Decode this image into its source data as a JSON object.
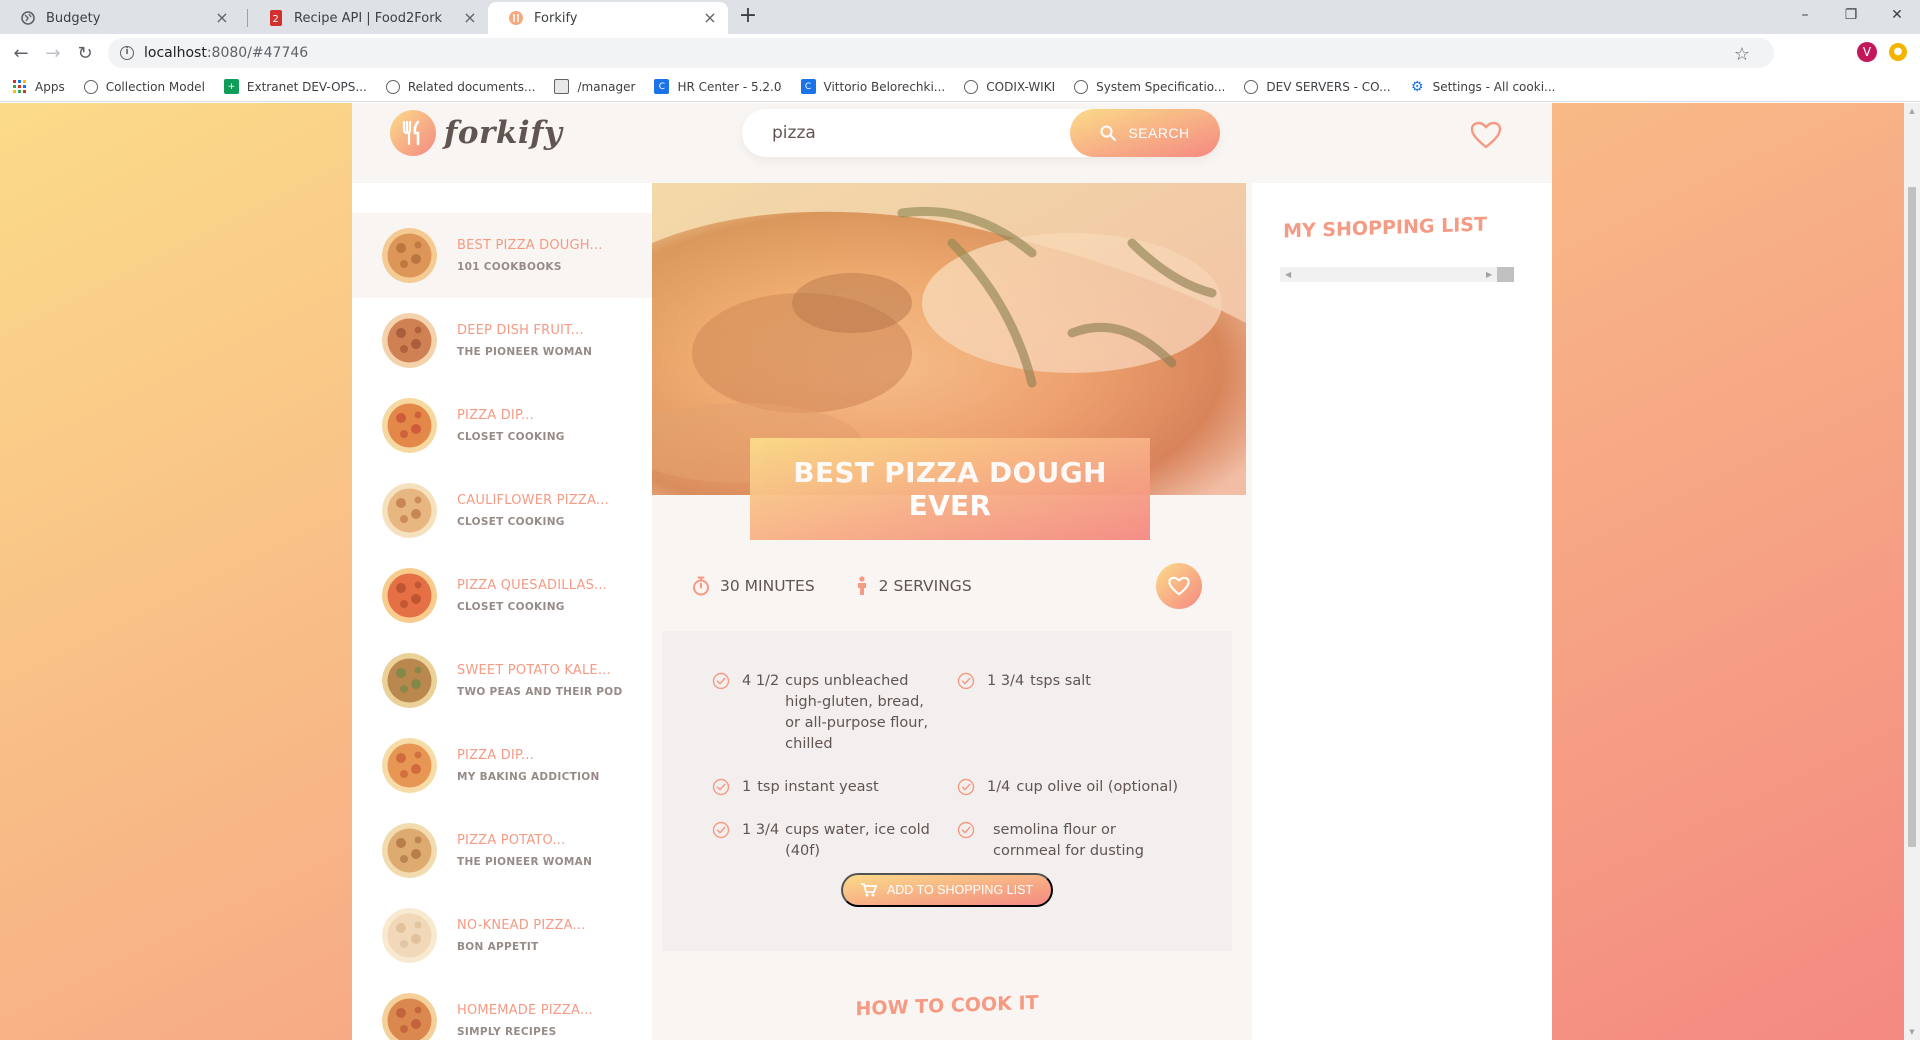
{
  "browser": {
    "tabs": [
      {
        "title": "Budgety",
        "icon": "globe-icon"
      },
      {
        "title": "Recipe API | Food2Fork",
        "icon": "food2fork-icon"
      },
      {
        "title": "Forkify",
        "icon": "forkify-icon"
      }
    ],
    "url": {
      "host": "localhost",
      "path": ":8080/#47746"
    },
    "profile_initial": "V",
    "bookmarks": [
      {
        "label": "Apps",
        "icon": "apps-grid-icon"
      },
      {
        "label": "Collection Model",
        "icon": "globe-icon"
      },
      {
        "label": "Extranet DEV-OPS...",
        "icon": "extranet-icon"
      },
      {
        "label": "Related documents...",
        "icon": "globe-icon"
      },
      {
        "label": "/manager",
        "icon": "image-icon"
      },
      {
        "label": "HR Center - 5.2.0",
        "icon": "confluence-icon"
      },
      {
        "label": "Vittorio Belorechki...",
        "icon": "confluence-icon"
      },
      {
        "label": "CODIX-WIKI",
        "icon": "globe-icon"
      },
      {
        "label": "System Specificatio...",
        "icon": "globe-icon"
      },
      {
        "label": "DEV SERVERS - CO...",
        "icon": "globe-icon"
      },
      {
        "label": "Settings - All cooki...",
        "icon": "settings-gear-icon"
      }
    ]
  },
  "app": {
    "logo_text": "forkify",
    "search": {
      "value": "pizza",
      "button_label": "SEARCH"
    },
    "results": [
      {
        "title": "BEST PIZZA DOUGH...",
        "author": "101 COOKBOOKS",
        "active": true
      },
      {
        "title": "DEEP DISH FRUIT...",
        "author": "THE PIONEER WOMAN"
      },
      {
        "title": "PIZZA DIP...",
        "author": "CLOSET COOKING"
      },
      {
        "title": "CAULIFLOWER PIZZA...",
        "author": "CLOSET COOKING"
      },
      {
        "title": "PIZZA QUESADILLAS...",
        "author": "CLOSET COOKING"
      },
      {
        "title": "SWEET POTATO KALE...",
        "author": "TWO PEAS AND THEIR POD"
      },
      {
        "title": "PIZZA DIP...",
        "author": "MY BAKING ADDICTION"
      },
      {
        "title": "PIZZA POTATO...",
        "author": "THE PIONEER WOMAN"
      },
      {
        "title": "NO-KNEAD PIZZA...",
        "author": "BON APPETIT"
      },
      {
        "title": "HOMEMADE PIZZA...",
        "author": "SIMPLY RECIPES"
      }
    ],
    "recipe": {
      "title": "BEST PIZZA DOUGH EVER",
      "time": "30",
      "time_unit": "MINUTES",
      "servings": "2",
      "servings_unit": "SERVINGS",
      "ingredients": [
        {
          "count": "4 1/2",
          "text": "cups unbleached high-gluten, bread, or all-purpose flour, chilled"
        },
        {
          "count": "1 3/4",
          "text": "tsps salt"
        },
        {
          "count": "1",
          "text": "tsp instant yeast"
        },
        {
          "count": "1/4",
          "text": "cup olive oil (optional)"
        },
        {
          "count": "1 3/4",
          "text": "cups water, ice cold (40f)"
        },
        {
          "count": "",
          "text": "semolina flour or cornmeal for dusting"
        }
      ],
      "add_to_list_label": "ADD TO SHOPPING LIST",
      "directions_title": "HOW TO COOK IT"
    },
    "shopping": {
      "title": "MY SHOPPING LIST"
    }
  },
  "colors": {
    "accent_start": "#fbdb89",
    "accent_end": "#f48982",
    "text": "#615551",
    "accent_text": "#f59a83"
  }
}
